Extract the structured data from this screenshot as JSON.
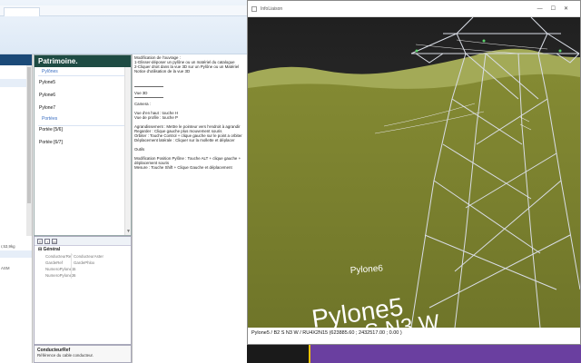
{
  "patrimoine": {
    "title": "Patrimoine.",
    "groups": [
      {
        "label": "Pylônes",
        "items": [
          "Pylone5",
          "Pylone6",
          "Pylone7"
        ]
      },
      {
        "label": "Portées",
        "items": [
          "Portée [5/6]",
          "Portée [6/7]"
        ]
      }
    ]
  },
  "left_rows": [
    "",
    "",
    ""
  ],
  "left_lower_rows": [
    "",
    "r,53,9kg",
    "",
    "",
    "ASM",
    "",
    ""
  ],
  "instructions": {
    "lines_top": [
      "Modification de l'ouvrage :",
      "1-Glisser-déposer un pylône ou un matériel du catalogue",
      "2-Cliquer droit dans la vue 3D sur un Pylône ou un Matériel",
      "Notice d'utilisation de la vue 3D"
    ],
    "view_label": "Vue 3D",
    "camera_lines": [
      "Camera :",
      "",
      "Vue d'en haut : touche H",
      "Vue de profile : touche P",
      "",
      "Agrandissement : Mettre le pointeur vers l'endroit à agrandir",
      "Regarder : Clique gauche plus mouvement souris",
      "Orbiter : Touche Control + clique gauche sur le point a orbiter",
      "Déplacement latérale : Cliquer sur la mollette et déplacer"
    ],
    "tools_lines": [
      "Outils",
      "",
      "Modification Position Pylône : Touche ALT + clique gauche +",
      "déplacement souris",
      "Mesure : Touche Shift + Clique Gauche et déplacement"
    ]
  },
  "props": {
    "category": "Général",
    "rows": [
      {
        "k": "ConducteurRef",
        "v": "ConducteurAster"
      },
      {
        "k": "GardeRef",
        "v": "GardePhlox"
      },
      {
        "k": "NumeroPylone1",
        "v": "5"
      },
      {
        "k": "NumeroPylone2",
        "v": "6"
      }
    ],
    "desc_title": "ConducteurRef",
    "desc_text": "Référence du cable conducteur."
  },
  "viewer": {
    "title": "InfoLiaison",
    "win_buttons": "—☐✕",
    "label_small": "Pylone6",
    "label_big1": "Pylone5",
    "label_big2": "S N3 W",
    "label_big3": "r4 5",
    "status": "Pylone5 / B2 S N3 W / RU4X2N15 (623885.60 ; 2432517.00 ; 0.00 )",
    "colors": {
      "sky": "#2f2f2f",
      "grass": "#7f852f",
      "hills": "#a7ae5a",
      "tower": "#d9dde6"
    }
  }
}
